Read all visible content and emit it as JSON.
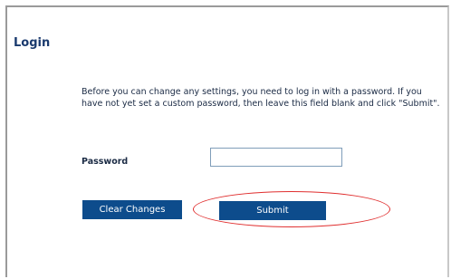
{
  "login": {
    "title": "Login",
    "instructions": "Before you can change any settings, you need to log in with a password. If you have not yet set a custom password, then leave this field blank and click \"Submit\".",
    "password_label": "Password",
    "password_value": "",
    "clear_button": "Clear Changes",
    "submit_button": "Submit"
  },
  "colors": {
    "title": "#1a3a6e",
    "button_bg": "#0d4c8c",
    "button_text": "#ffffff",
    "highlight": "#e03030"
  }
}
